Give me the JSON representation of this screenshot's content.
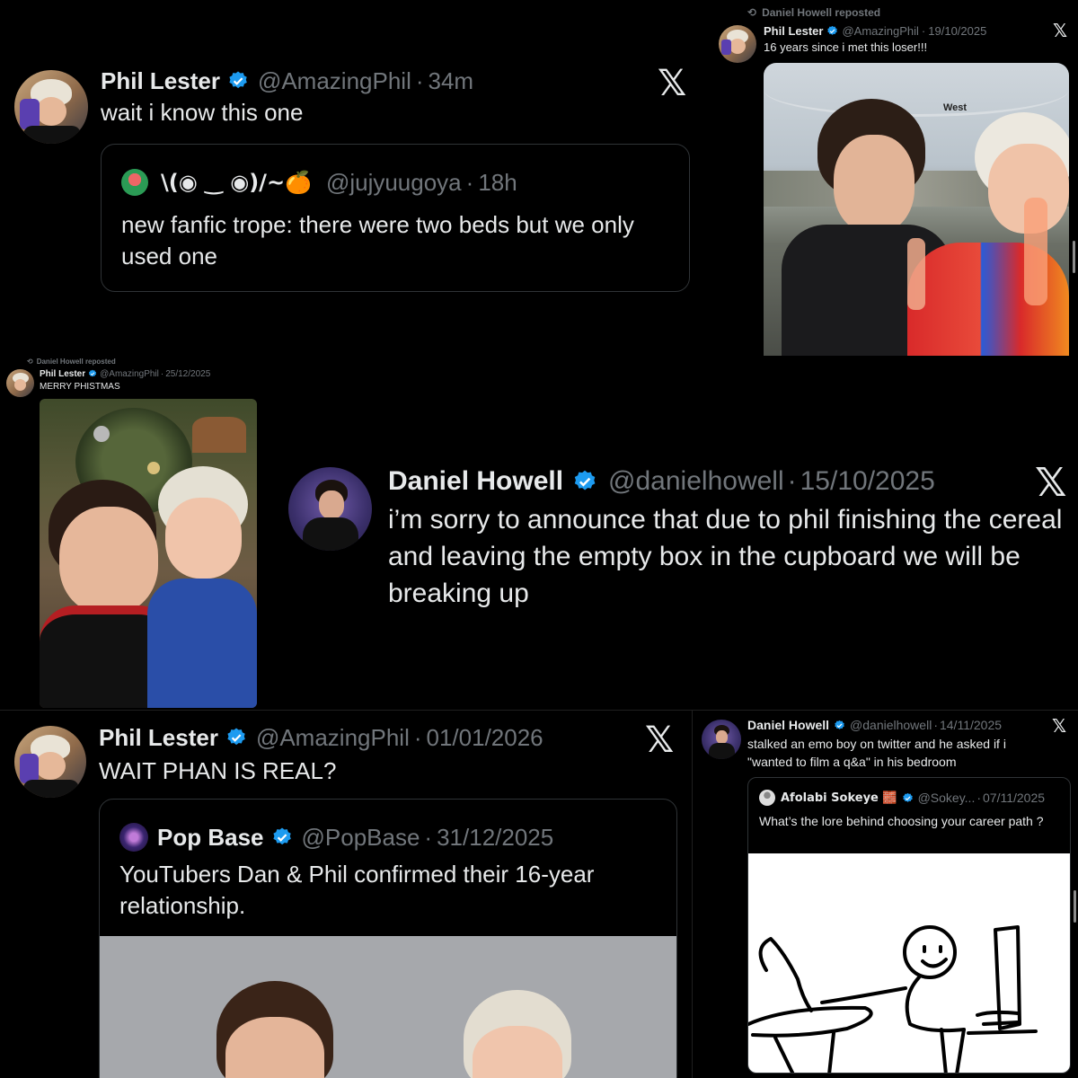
{
  "colors": {
    "background": "#000000",
    "text": "#e7e9ea",
    "muted": "#71767b",
    "verified": "#1d9bf0",
    "border": "#2f3336"
  },
  "panel1": {
    "author_name": "Phil Lester",
    "author_handle": "@AmazingPhil",
    "separator": "·",
    "time": "34m",
    "text": "wait i know this one",
    "x_icon": "x-logo-icon",
    "quote": {
      "author_name": "\\(◉ ‿ ◉)/~🍊",
      "author_handle": "@jujyuugoya",
      "separator": "·",
      "time": "18h",
      "text": "new fanfic trope: there were two beds but we only used one"
    }
  },
  "panel2": {
    "repost_label": "Daniel Howell reposted",
    "author_name": "Phil Lester",
    "author_handle": "@AmazingPhil",
    "separator": "·",
    "date": "19/10/2025",
    "text": "16 years since i met this loser!!!",
    "photo_sign": "West"
  },
  "panel3": {
    "repost_label": "Daniel Howell reposted",
    "author_name": "Phil Lester",
    "author_handle": "@AmazingPhil",
    "separator": "·",
    "date": "25/12/2025",
    "text": "MERRY PHISTMAS"
  },
  "panel4": {
    "author_name": "Daniel Howell",
    "author_handle": "@danielhowell",
    "separator": "·",
    "date": "15/10/2025",
    "text": "i’m sorry to announce that due to phil finishing the cereal and leaving the empty box in the cupboard we will be breaking up"
  },
  "panel5": {
    "author_name": "Phil Lester",
    "author_handle": "@AmazingPhil",
    "separator": "·",
    "date": "01/01/2026",
    "text": "WAIT PHAN IS REAL?",
    "quote": {
      "author_name": "Pop Base",
      "author_handle": "@PopBase",
      "separator": "·",
      "date": "31/12/2025",
      "text": "YouTubers Dan & Phil confirmed their 16-year relationship."
    }
  },
  "panel6": {
    "author_name": "Daniel Howell",
    "author_handle": "@danielhowell",
    "separator": "·",
    "date": "14/11/2025",
    "text": "stalked an emo boy on twitter and he asked if i \"wanted to film a q&a\" in his bedroom",
    "quote": {
      "author_name": "Afolabi Sokeye 🧱",
      "author_handle": "@Sokey...",
      "separator": "·",
      "date": "07/11/2025",
      "text": "What’s the lore behind choosing your career path ?"
    }
  }
}
